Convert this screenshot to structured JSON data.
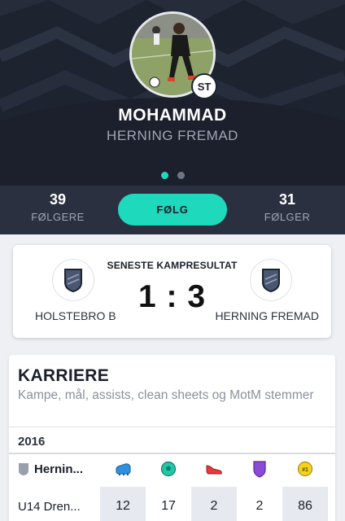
{
  "player": {
    "name": "MOHAMMAD",
    "club": "HERNING FREMAD",
    "position": "ST"
  },
  "pagination": {
    "pages": 2,
    "active": 0
  },
  "stats": {
    "followers_count": "39",
    "followers_label": "FØLGERE",
    "following_count": "31",
    "following_label": "FØLGER",
    "follow_button": "FØLG"
  },
  "last_match": {
    "title": "SENESTE KAMPRESULTAT",
    "score": "1 : 3",
    "home_team": "HOLSTEBRO B",
    "away_team": "HERNING FREMAD"
  },
  "career": {
    "title": "KARRIERE",
    "subtitle": "Kampe, mål, assists, clean sheets og MotM stemmer",
    "year": "2016",
    "team_row_label": "Hernin...",
    "columns": [
      "boot-icon",
      "ball-icon",
      "assist-boot-icon",
      "shield-icon",
      "motm-medal-icon"
    ],
    "competition": {
      "label": "U14 Dren...",
      "values": [
        "12",
        "17",
        "2",
        "2",
        "86"
      ]
    }
  },
  "colors": {
    "accent": "#1fd9bd",
    "hero_bg": "#1e2330",
    "stats_bg": "#2a3040"
  }
}
